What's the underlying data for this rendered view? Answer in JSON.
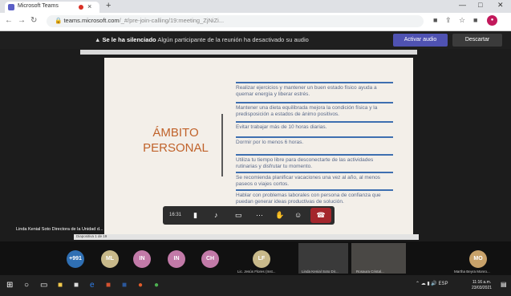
{
  "browser": {
    "tab_title": "Microsoft Teams",
    "tab_close": "×",
    "new_tab": "+",
    "url_domain": "teams.microsoft.com",
    "url_path": "/_#/pre-join-calling/19:meeting_ZjNiZi...",
    "win_min": "—",
    "win_max": "□",
    "win_close": "✕",
    "profile_initials": "●"
  },
  "notification": {
    "bold": "Se le ha silenciado",
    "text": "Algún participante de la reunión ha desactivado su audio",
    "activate_label": "Activar audio",
    "dismiss_label": "Descartar"
  },
  "slide": {
    "title_line1": "ÁMBITO",
    "title_line2": "PERSONAL",
    "items": [
      "Realizar ejercicios y mantener un buen estado físico ayuda a quemar energía y liberar estrés.",
      "Mantener una dieta equilibrada mejora la condición física y la predisposición a estados de ánimo positivos.",
      "Evitar trabajar más de 10 horas diarias.",
      "Dormir por lo menos 6 horas.",
      "Utiliza tu tiempo libre para desconectarte de las actividades rutinarias y disfrutar tu momento.",
      "Se recomienda planificar vacaciones una vez al año, al menos paseos o viajes cortos.",
      "Hablar con problemas laborales con persona de confianza que puedan generar ideas productivas de solución."
    ]
  },
  "presenter_label": "Linda Kenial Soto Directora de la Unidad d...",
  "share_label": "Diapositiva 1 de 19",
  "callbar": {
    "timer": "16:31",
    "icons": [
      "camera-icon",
      "mic-off-icon",
      "share-icon",
      "more-icon",
      "hand-icon",
      "reactions-icon",
      "hangup-icon"
    ]
  },
  "participants": [
    {
      "initials": "+991",
      "color": "#2f6fb3"
    },
    {
      "initials": "ML",
      "color": "#c8b98a"
    },
    {
      "initials": "IN",
      "color": "#c27aa8"
    },
    {
      "initials": "IN",
      "color": "#c27aa8"
    },
    {
      "initials": "CH",
      "color": "#c27aa8"
    },
    {
      "initials": "LF",
      "color": "#c8b98a"
    },
    {
      "initials": "MO",
      "color": "#c8a26a"
    }
  ],
  "participant_names": {
    "lf": "Lic. Jesús Flores (Inst...",
    "video1": "Linda Kenial Soto Dir...",
    "video2": "Rosaura Cristal...",
    "mo": "Martha Beyra Monro..."
  },
  "taskbar": {
    "time": "11:16 a.m.",
    "date": "23/03/2021"
  }
}
